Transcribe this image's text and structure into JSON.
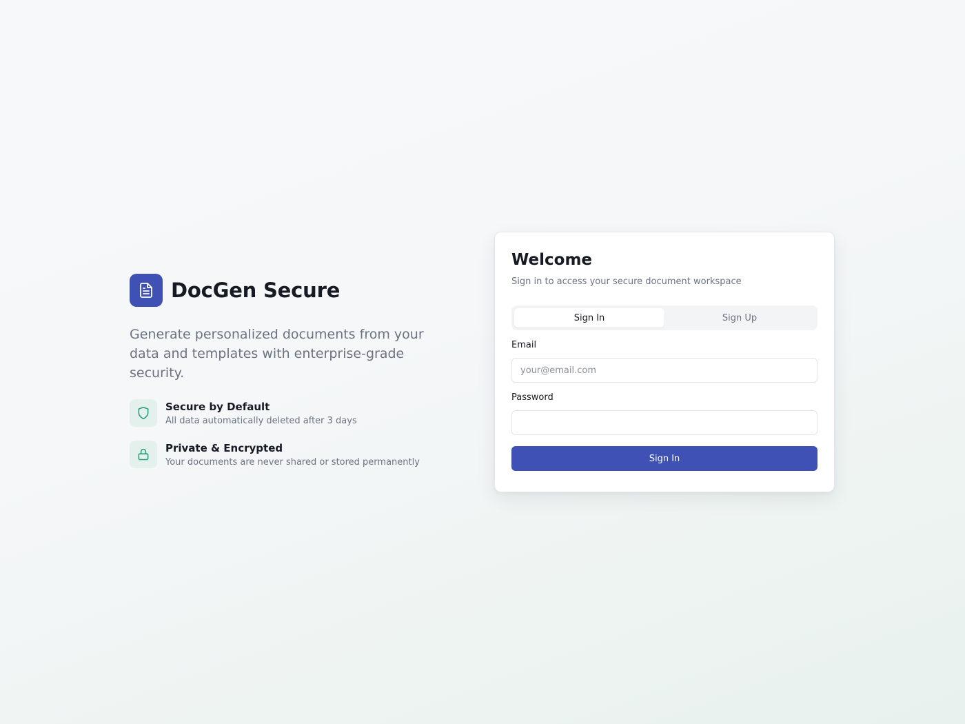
{
  "brand": {
    "name": "DocGen Secure",
    "logo_icon": "document-icon",
    "accent_color": "#3f51b5"
  },
  "hero": {
    "tagline": "Generate personalized documents from your data and templates with enterprise-grade security.",
    "features": [
      {
        "icon": "shield-icon",
        "title": "Secure by Default",
        "description": "All data automatically deleted after 3 days"
      },
      {
        "icon": "lock-icon",
        "title": "Private & Encrypted",
        "description": "Your documents are never shared or stored permanently"
      }
    ],
    "feature_icon_color": "#2a9d7f"
  },
  "auth": {
    "title": "Welcome",
    "subtitle": "Sign in to access your secure document workspace",
    "tabs": [
      {
        "label": "Sign In",
        "active": true
      },
      {
        "label": "Sign Up",
        "active": false
      }
    ],
    "email": {
      "label": "Email",
      "placeholder": "your@email.com",
      "value": ""
    },
    "password": {
      "label": "Password",
      "placeholder": "",
      "value": ""
    },
    "submit_label": "Sign In"
  }
}
